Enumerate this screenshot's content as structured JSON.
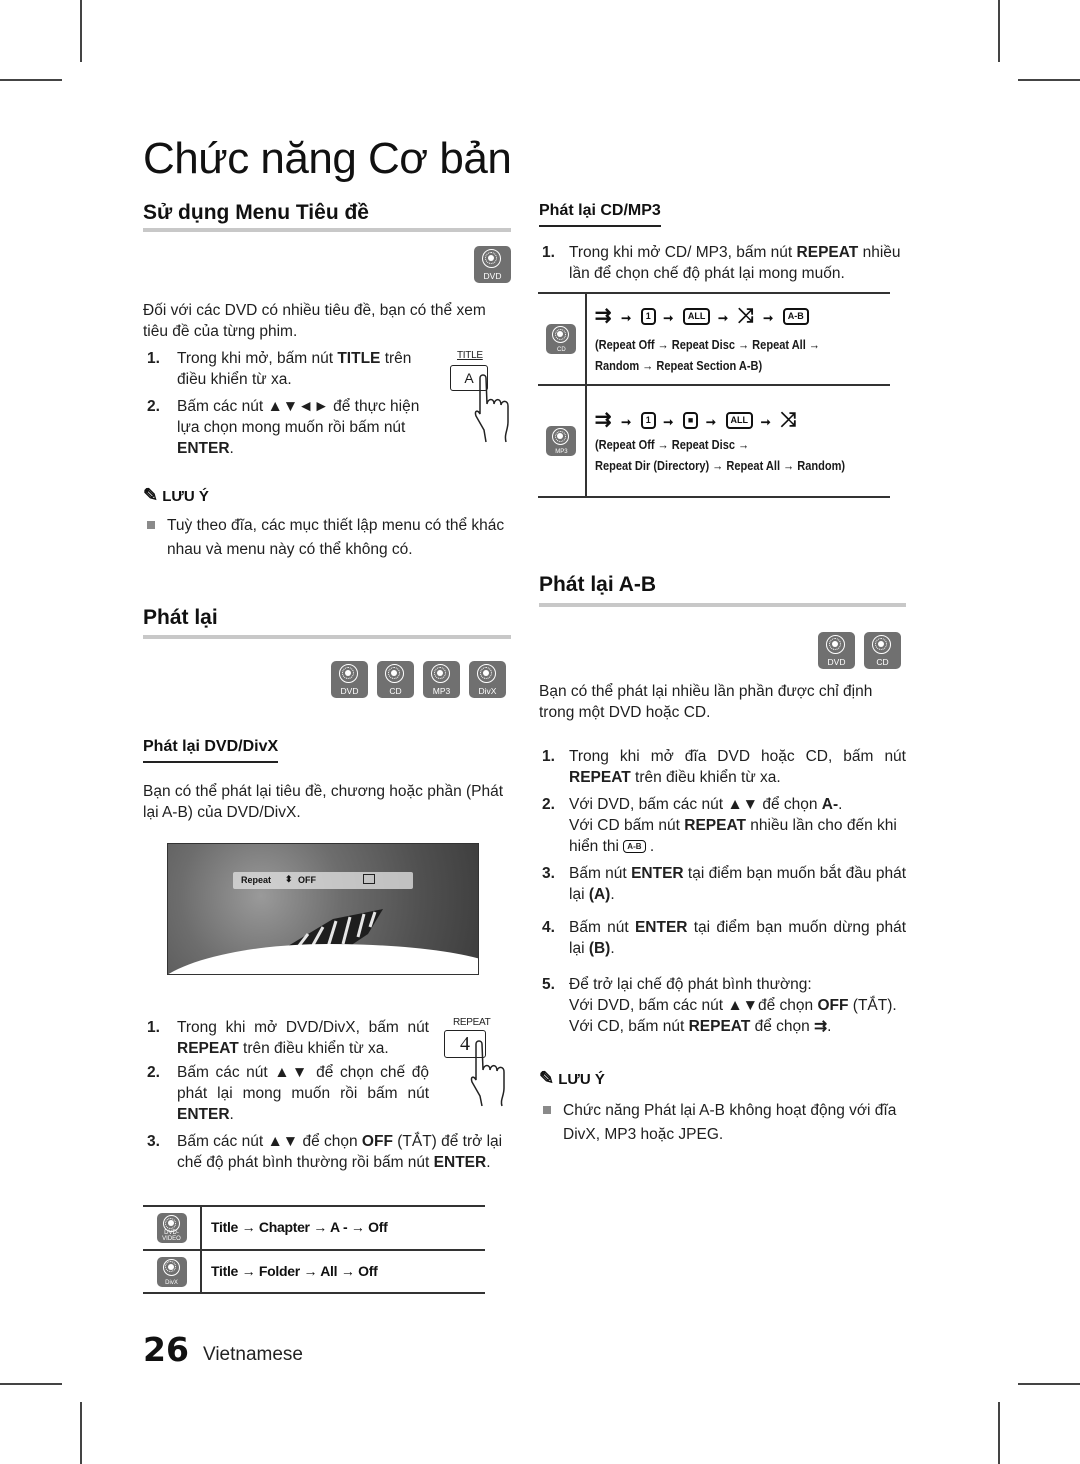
{
  "page": {
    "title": "Chức năng Cơ bản",
    "page_number": "26",
    "language": "Vietnamese"
  },
  "title_menu": {
    "heading": "Sử dụng Menu Tiêu đề",
    "disc_icons": [
      "DVD"
    ],
    "intro": "Đối với các DVD có nhiều tiêu đề, bạn có thể xem tiêu đề của từng phim.",
    "steps": [
      {
        "num": "1.",
        "pre": "Trong khi mở, bấm nút ",
        "bold": "TITLE",
        "post": " trên điều khiển từ xa."
      },
      {
        "num": "2.",
        "pre": "Bấm các nút  ▲▼◄► để thực hiện lựa chọn mong muốn rồi bấm nút ",
        "bold": "ENTER",
        "post": "."
      }
    ],
    "remote": {
      "label": "TITLE",
      "key": "A"
    },
    "note_heading": "LƯU Ý",
    "notes": [
      "Tuỳ theo đĩa, các mục thiết lập menu có thể khác nhau và menu này có thể không có."
    ]
  },
  "playback": {
    "heading": "Phát lại",
    "disc_icons": [
      "DVD",
      "CD",
      "MP3",
      "DivX"
    ]
  },
  "dvd_divx": {
    "heading": "Phát lại DVD/DivX",
    "intro": "Bạn có thể phát lại tiêu đề, chương hoặc phần (Phát lại A-B) của DVD/DivX.",
    "osd": {
      "label": "Repeat",
      "arrow": "⬍",
      "value": "OFF",
      "icon": "enter-icon"
    },
    "remote": {
      "label": "REPEAT",
      "key": "4"
    },
    "steps": [
      {
        "num": "1.",
        "pre": "Trong khi mở DVD/DivX, bấm nút ",
        "bold": "REPEAT",
        "post": " trên điều khiển từ xa."
      },
      {
        "num": "2.",
        "pre": "Bấm các nút ▲▼ để chọn chế độ phát lại mong muốn rồi bấm nút ",
        "bold": "ENTER",
        "post": "."
      },
      {
        "num": "3.",
        "pre": "Bấm các nút ▲▼ để chọn ",
        "bold": "OFF",
        "post": " (TẮT) để trở lại chế độ phát bình thường rồi bấm nút ",
        "bold2": "ENTER",
        "post2": "."
      }
    ],
    "modes_table": [
      {
        "disc": "DVD-VIDEO",
        "sequence": "Title → Chapter → A - → Off"
      },
      {
        "disc": "DivX",
        "sequence": "Title → Folder → All → Off"
      }
    ]
  },
  "cd_mp3": {
    "heading": "Phát lại CD/MP3",
    "steps": [
      {
        "num": "1.",
        "pre": "Trong khi mở CD/ MP3, bấm nút ",
        "bold": "REPEAT",
        "post": " nhiều lần để chọn chế độ phát lại mong muốn."
      }
    ],
    "modes_table": [
      {
        "disc": "CD",
        "icons": [
          "repeat-off",
          "repeat-disc",
          "repeat-all",
          "random",
          "repeat-ab"
        ],
        "desc_line1": "(Repeat Off → Repeat Disc → Repeat All →",
        "desc_line2": "Random → Repeat Section A-B)"
      },
      {
        "disc": "MP3",
        "icons": [
          "repeat-off",
          "repeat-disc",
          "repeat-dir",
          "repeat-all",
          "random"
        ],
        "desc_line1": "(Repeat Off → Repeat Disc →",
        "desc_line2": "Repeat Dir (Directory) → Repeat All → Random)"
      }
    ],
    "icon_labels": {
      "one": "1",
      "all": "ALL",
      "ab": "A-B"
    }
  },
  "ab_repeat": {
    "heading": "Phát lại A-B",
    "disc_icons": [
      "DVD",
      "CD"
    ],
    "intro": "Bạn có thể phát lại nhiều lần phần được chỉ định trong một DVD hoặc CD.",
    "steps": [
      {
        "num": "1.",
        "pre": "Trong khi mở đĩa DVD hoặc CD, bấm nút ",
        "bold": "REPEAT",
        "post": " trên điều khiển từ xa."
      },
      {
        "num": "2.",
        "pre": "Với DVD, bấm các nút ▲▼ để chọn ",
        "bold": "A-",
        "post": ".",
        "line2_pre": "Với CD bấm nút ",
        "line2_bold": "REPEAT",
        "line2_post": " nhiều lần cho đến khi hiển thi ",
        "line2_end": " ."
      },
      {
        "num": "3.",
        "pre": "Bấm nút ",
        "bold": "ENTER",
        "post": " tại điểm bạn muốn bắt đầu phát lại ",
        "bold2": "(A)",
        "post2": "."
      },
      {
        "num": "4.",
        "pre": "Bấm nút ",
        "bold": "ENTER",
        "post": " tại điểm bạn muốn dừng phát lại ",
        "bold2": "(B)",
        "post2": "."
      },
      {
        "num": "5.",
        "line1": "Để trở lại chế độ phát bình thường:",
        "line2_pre": "Với DVD, bấm các nút  ▲▼để chọn ",
        "line2_bold": "OFF",
        "line2_post": " (TẮT).",
        "line3_pre": "Với CD, bấm nút ",
        "line3_bold": "REPEAT",
        "line3_post": " để chọn ",
        "line3_end": "."
      }
    ],
    "note_heading": "LƯU Ý",
    "notes": [
      "Chức năng Phát lại A-B không hoạt động với đĩa DivX, MP3 hoặc JPEG."
    ]
  }
}
